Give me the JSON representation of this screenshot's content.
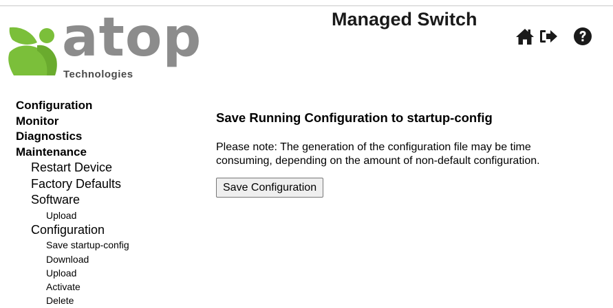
{
  "header": {
    "title": "Managed Switch",
    "logo": {
      "word": "atop",
      "sub": "Technologies",
      "brand_green": "#7bbf3a",
      "brand_gray": "#8c8c8c"
    },
    "icons": [
      "home-icon",
      "logout-icon",
      "help-icon"
    ]
  },
  "nav": {
    "configuration": "Configuration",
    "monitor": "Monitor",
    "diagnostics": "Diagnostics",
    "maintenance": "Maintenance",
    "restart_device": "Restart Device",
    "factory_defaults": "Factory Defaults",
    "software": "Software",
    "software_upload": "Upload",
    "config_group": "Configuration",
    "save_startup": "Save startup-config",
    "download": "Download",
    "upload": "Upload",
    "activate": "Activate",
    "delete": "Delete"
  },
  "main": {
    "title": "Save Running Configuration to startup-config",
    "note_line1": "Please note: The generation of the configuration file may be time",
    "note_line2": "consuming, depending on the amount of non-default configuration.",
    "save_button": "Save Configuration"
  }
}
